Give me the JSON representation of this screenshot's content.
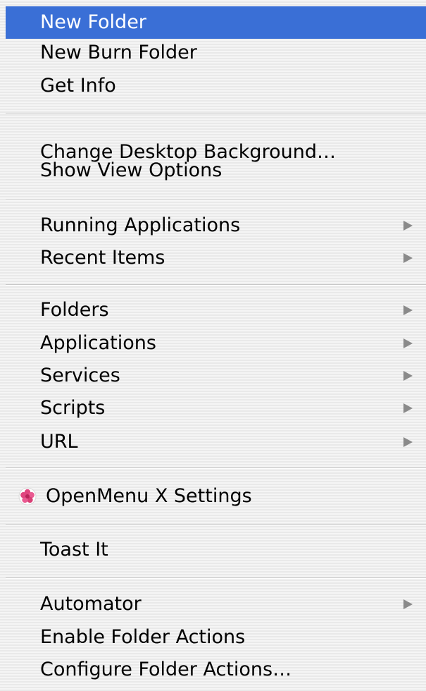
{
  "menu": {
    "items": [
      {
        "label": "New Folder"
      },
      {
        "label": "New Burn Folder"
      },
      {
        "label": "Get Info"
      },
      {
        "label": "Change Desktop Background…"
      },
      {
        "label": "Show View Options"
      },
      {
        "label": "Running Applications"
      },
      {
        "label": "Recent Items"
      },
      {
        "label": "Folders"
      },
      {
        "label": "Applications"
      },
      {
        "label": "Services"
      },
      {
        "label": "Scripts"
      },
      {
        "label": "URL"
      },
      {
        "label": "OpenMenu X Settings",
        "icon": "openmenu-x-flower-icon"
      },
      {
        "label": "Toast It"
      },
      {
        "label": "Automator"
      },
      {
        "label": "Enable Folder Actions"
      },
      {
        "label": "Configure Folder Actions…"
      }
    ],
    "selected_item": "New Folder",
    "submenu_arrow_icon": "submenu-arrow-icon",
    "colors": {
      "highlight": "#3a6fd6",
      "highlight_text": "#ffffff",
      "text": "#000000",
      "arrow": "#8a8a8a"
    }
  }
}
